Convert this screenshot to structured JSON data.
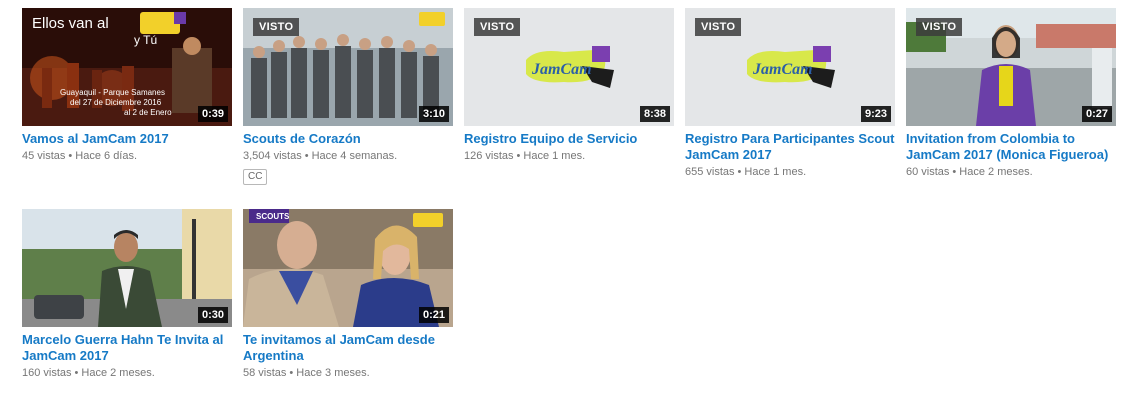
{
  "videos_row1": [
    {
      "title": "Vamos al JamCam 2017",
      "views": "45 vistas",
      "sep": "•",
      "age": "Hace 6 días.",
      "duration": "0:39",
      "watched": "",
      "cc": "",
      "thumb_text": [
        "Ellos van al",
        "y Tú",
        "Guayaquil - Parque Samanes",
        "del 27 de Diciembre 2016",
        "al 2 de Enero"
      ]
    },
    {
      "title": "Scouts de Corazón",
      "views": "3,504 vistas",
      "sep": "•",
      "age": "Hace 4 semanas.",
      "duration": "3:10",
      "watched": "VISTO",
      "cc": "CC"
    },
    {
      "title": "Registro Equipo de Servicio",
      "views": "126 vistas",
      "sep": "•",
      "age": "Hace 1 mes.",
      "duration": "8:38",
      "watched": "VISTO",
      "cc": ""
    },
    {
      "title": "Registro Para Participantes Scout JamCam 2017",
      "views": "655 vistas",
      "sep": "•",
      "age": "Hace 1 mes.",
      "duration": "9:23",
      "watched": "VISTO",
      "cc": ""
    },
    {
      "title": "Invitation from Colombia to JamCam 2017 (Monica Figueroa)",
      "views": "60 vistas",
      "sep": "•",
      "age": "Hace 2 meses.",
      "duration": "0:27",
      "watched": "VISTO",
      "cc": ""
    }
  ],
  "videos_row2": [
    {
      "title": "Marcelo Guerra Hahn Te Invita al JamCam 2017",
      "views": "160 vistas",
      "sep": "•",
      "age": "Hace 2 meses.",
      "duration": "0:30",
      "watched": "",
      "cc": ""
    },
    {
      "title": "Te invitamos al JamCam desde Argentina",
      "views": "58 vistas",
      "sep": "•",
      "age": "Hace 3 meses.",
      "duration": "0:21",
      "watched": "",
      "cc": "",
      "thumb_badge": "SCOUTS"
    }
  ],
  "logo_text": "JamCam",
  "colors": {
    "link": "#167ac6",
    "meta": "#767676",
    "badge_bg": "#3c3c3c"
  }
}
